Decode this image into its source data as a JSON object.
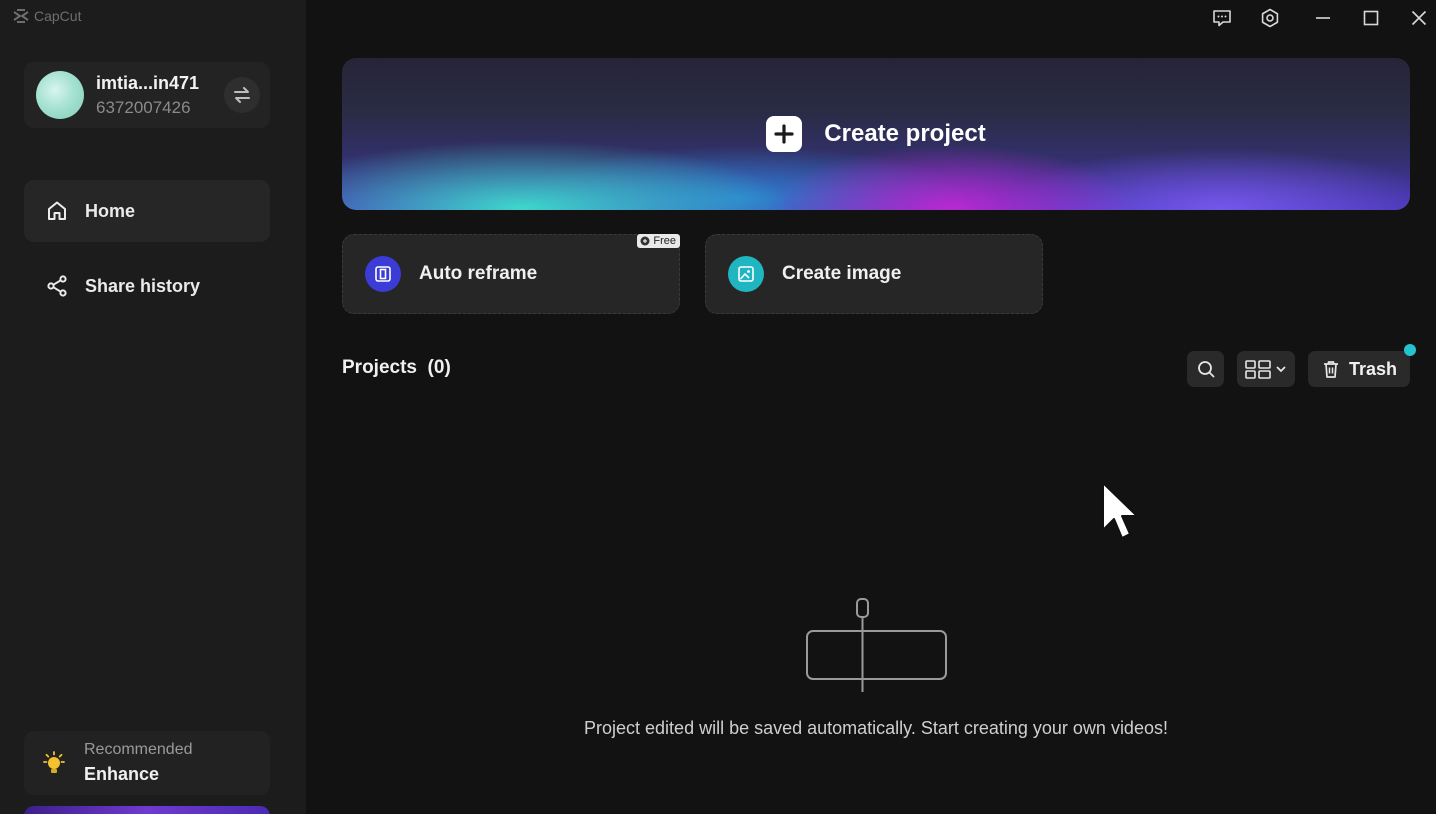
{
  "app": {
    "name": "CapCut"
  },
  "account": {
    "name": "imtia...in471",
    "id": "6372007426"
  },
  "sidebar": {
    "items": [
      {
        "label": "Home",
        "icon": "home-icon",
        "active": true
      },
      {
        "label": "Share history",
        "icon": "share-icon",
        "active": false
      }
    ],
    "recommend": {
      "label": "Recommended",
      "title": "Enhance"
    }
  },
  "create": {
    "label": "Create project"
  },
  "quick": {
    "auto_reframe": {
      "label": "Auto reframe",
      "badge": "Free",
      "color": "#3b3bd6"
    },
    "create_image": {
      "label": "Create image",
      "color": "#1fb6c1"
    }
  },
  "projects": {
    "title": "Projects",
    "count": "(0)",
    "trash_label": "Trash",
    "empty_message": "Project edited will be saved automatically. Start creating your own videos!"
  },
  "colors": {
    "accent": "#22c5cf",
    "bg": "#121212",
    "sidebar": "#1c1c1c"
  }
}
